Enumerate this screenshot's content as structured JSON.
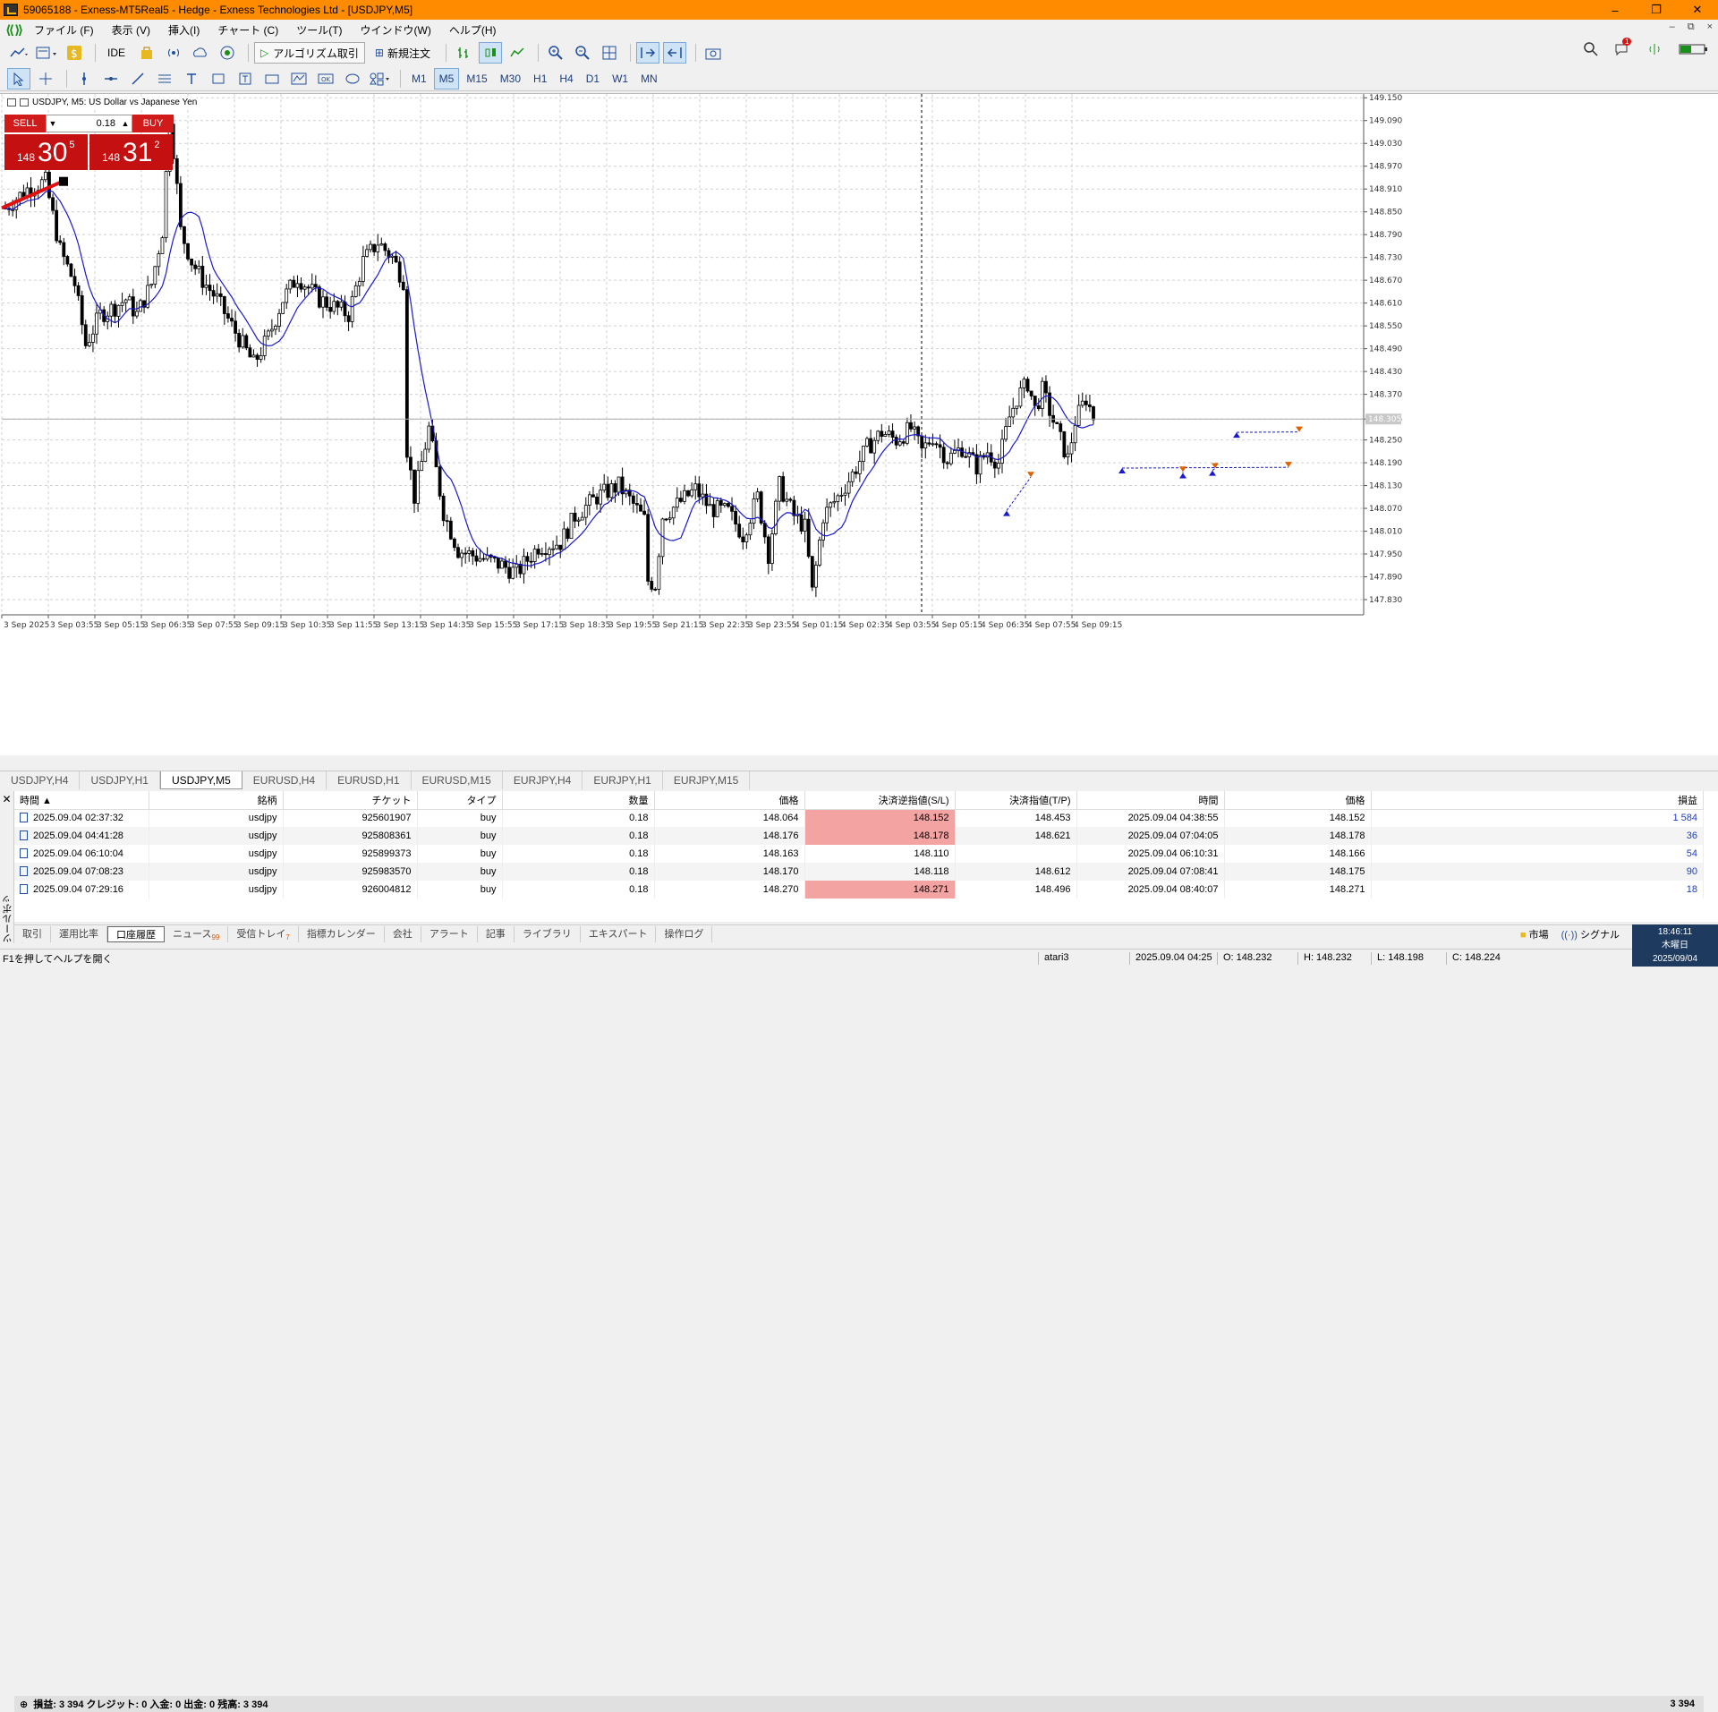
{
  "window": {
    "title": "59065188 - Exness-MT5Real5 - Hedge - Exness Technologies Ltd - [USDJPY,M5]",
    "controls": [
      "–",
      "❐",
      "✕"
    ]
  },
  "menu": {
    "items": [
      "ファイル (F)",
      "表示 (V)",
      "挿入(I)",
      "チャート (C)",
      "ツール(T)",
      "ウインドウ(W)",
      "ヘルプ(H)"
    ],
    "inner_controls": [
      "–",
      "⧉",
      "×"
    ]
  },
  "toolbar1": {
    "ide_label": "IDE",
    "algo_label": "アルゴリズム取引",
    "new_order_label": "新規注文",
    "notification_count": "1"
  },
  "toolbar2": {
    "timeframes": [
      "M1",
      "M5",
      "M15",
      "M30",
      "H1",
      "H4",
      "D1",
      "W1",
      "MN"
    ],
    "active_timeframe": "M5"
  },
  "chart_data": {
    "type": "candlestick",
    "title": "USDJPY, M5:  US Dollar vs Japanese Yen",
    "ylim": [
      147.79,
      149.16
    ],
    "y_ticks": [
      "149.150",
      "149.090",
      "149.030",
      "148.970",
      "148.910",
      "148.850",
      "148.790",
      "148.730",
      "148.670",
      "148.610",
      "148.550",
      "148.490",
      "148.430",
      "148.370",
      "148.305",
      "148.250",
      "148.190",
      "148.130",
      "148.070",
      "148.010",
      "147.950",
      "147.890",
      "147.830"
    ],
    "current_price": "148.305",
    "x_ticks": [
      "3 Sep 2025",
      "3 Sep 03:55",
      "3 Sep 05:15",
      "3 Sep 06:35",
      "3 Sep 07:55",
      "3 Sep 09:15",
      "3 Sep 10:35",
      "3 Sep 11:55",
      "3 Sep 13:15",
      "3 Sep 14:35",
      "3 Sep 15:55",
      "3 Sep 17:15",
      "3 Sep 18:35",
      "3 Sep 19:55",
      "3 Sep 21:15",
      "3 Sep 22:35",
      "3 Sep 23:55",
      "4 Sep 01:15",
      "4 Sep 02:35",
      "4 Sep 03:55",
      "4 Sep 05:15",
      "4 Sep 06:35",
      "4 Sep 07:55",
      "4 Sep 09:15"
    ],
    "price_path": [
      [
        0,
        148.86
      ],
      [
        30,
        148.91
      ],
      [
        55,
        148.93
      ],
      [
        75,
        148.75
      ],
      [
        95,
        148.66
      ],
      [
        110,
        148.5
      ],
      [
        130,
        148.58
      ],
      [
        150,
        148.6
      ],
      [
        165,
        148.62
      ],
      [
        180,
        148.58
      ],
      [
        200,
        148.66
      ],
      [
        215,
        148.8
      ],
      [
        225,
        149.1
      ],
      [
        232,
        148.98
      ],
      [
        240,
        148.8
      ],
      [
        255,
        148.72
      ],
      [
        270,
        148.67
      ],
      [
        290,
        148.62
      ],
      [
        310,
        148.55
      ],
      [
        340,
        148.45
      ],
      [
        360,
        148.52
      ],
      [
        380,
        148.62
      ],
      [
        400,
        148.68
      ],
      [
        430,
        148.62
      ],
      [
        450,
        148.6
      ],
      [
        470,
        148.58
      ],
      [
        490,
        148.72
      ],
      [
        510,
        148.77
      ],
      [
        530,
        148.73
      ],
      [
        545,
        148.67
      ],
      [
        548,
        148.25
      ],
      [
        560,
        148.1
      ],
      [
        580,
        148.28
      ],
      [
        600,
        148.06
      ],
      [
        620,
        147.96
      ],
      [
        650,
        147.94
      ],
      [
        680,
        147.92
      ],
      [
        700,
        147.9
      ],
      [
        730,
        147.97
      ],
      [
        760,
        147.98
      ],
      [
        780,
        148.05
      ],
      [
        810,
        148.1
      ],
      [
        840,
        148.13
      ],
      [
        860,
        148.08
      ],
      [
        875,
        148.04
      ],
      [
        880,
        147.88
      ],
      [
        890,
        147.87
      ],
      [
        900,
        148.05
      ],
      [
        920,
        148.08
      ],
      [
        945,
        148.12
      ],
      [
        965,
        148.07
      ],
      [
        990,
        148.06
      ],
      [
        1010,
        148.0
      ],
      [
        1030,
        148.1
      ],
      [
        1045,
        147.95
      ],
      [
        1060,
        148.13
      ],
      [
        1080,
        148.05
      ],
      [
        1095,
        148.02
      ],
      [
        1105,
        147.85
      ],
      [
        1120,
        148.05
      ],
      [
        1140,
        148.1
      ],
      [
        1160,
        148.16
      ],
      [
        1180,
        148.23
      ],
      [
        1200,
        148.27
      ],
      [
        1220,
        148.25
      ],
      [
        1240,
        148.28
      ],
      [
        1255,
        148.22
      ],
      [
        1270,
        148.26
      ],
      [
        1290,
        148.2
      ],
      [
        1310,
        148.23
      ],
      [
        1330,
        148.18
      ],
      [
        1345,
        148.22
      ],
      [
        1360,
        148.19
      ],
      [
        1375,
        148.31
      ],
      [
        1385,
        148.36
      ],
      [
        1400,
        148.4
      ],
      [
        1410,
        148.33
      ],
      [
        1420,
        148.38
      ],
      [
        1435,
        148.3
      ],
      [
        1445,
        148.25
      ],
      [
        1455,
        148.2
      ],
      [
        1465,
        148.3
      ],
      [
        1480,
        148.36
      ],
      [
        1490,
        148.31
      ]
    ]
  },
  "one_click": {
    "sell_label": "SELL",
    "buy_label": "BUY",
    "lot": "0.18",
    "sell_prefix": "148",
    "sell_big": "30",
    "sell_sup": "5",
    "buy_prefix": "148",
    "buy_big": "31",
    "buy_sup": "2"
  },
  "chart_tabs": [
    "USDJPY,H4",
    "USDJPY,H1",
    "USDJPY,M5",
    "EURUSD,H4",
    "EURUSD,H1",
    "EURUSD,M15",
    "EURJPY,H4",
    "EURJPY,H1",
    "EURJPY,M15"
  ],
  "active_chart_tab": "USDJPY,M5",
  "history": {
    "headers": [
      "時間",
      "銘柄",
      "チケット",
      "タイプ",
      "数量",
      "価格",
      "決済逆指値(S/L)",
      "決済指値(T/P)",
      "時間",
      "価格",
      "損益"
    ],
    "rows": [
      [
        "2025.09.04 02:37:32",
        "usdjpy",
        "925601907",
        "buy",
        "0.18",
        "148.064",
        "148.152",
        "148.453",
        "2025.09.04 04:38:55",
        "148.152",
        "1 584"
      ],
      [
        "2025.09.04 04:41:28",
        "usdjpy",
        "925808361",
        "buy",
        "0.18",
        "148.176",
        "148.178",
        "148.621",
        "2025.09.04 07:04:05",
        "148.178",
        "36"
      ],
      [
        "2025.09.04 06:10:04",
        "usdjpy",
        "925899373",
        "buy",
        "0.18",
        "148.163",
        "148.110",
        "",
        "2025.09.04 06:10:31",
        "148.166",
        "54"
      ],
      [
        "2025.09.04 07:08:23",
        "usdjpy",
        "925983570",
        "buy",
        "0.18",
        "148.170",
        "148.118",
        "148.612",
        "2025.09.04 07:08:41",
        "148.175",
        "90"
      ],
      [
        "2025.09.04 07:29:16",
        "usdjpy",
        "926004812",
        "buy",
        "0.18",
        "148.270",
        "148.271",
        "148.496",
        "2025.09.04 08:40:07",
        "148.271",
        "18"
      ]
    ],
    "sl_hit_rows": [
      0,
      1,
      4
    ],
    "summary": "損益: 3 394  クレジット: 0  入金: 0  出金: 0  残高: 3 394",
    "summary_total": "3 394"
  },
  "toolbox_label": "ツールボックス",
  "bottom_tabs": [
    "取引",
    "運用比率",
    "口座履歴",
    "ニュース",
    "受信トレイ",
    "指標カレンダー",
    "会社",
    "アラート",
    "記事",
    "ライブラリ",
    "エキスパート",
    "操作ログ"
  ],
  "bottom_tab_badges": {
    "news": "99",
    "inbox": "7"
  },
  "active_bottom_tab": "口座履歴",
  "bottom_right": {
    "market": "市場",
    "signals": "シグナル"
  },
  "clock": {
    "time": "18:46:11",
    "day": "木曜日",
    "date": "2025/09/04"
  },
  "status": {
    "help": "F1を押してヘルプを開く",
    "profile": "atari3",
    "datetime": "2025.09.04 04:25",
    "open": "O: 148.232",
    "high": "H: 148.232",
    "low": "L: 148.198",
    "close": "C: 148.224"
  }
}
